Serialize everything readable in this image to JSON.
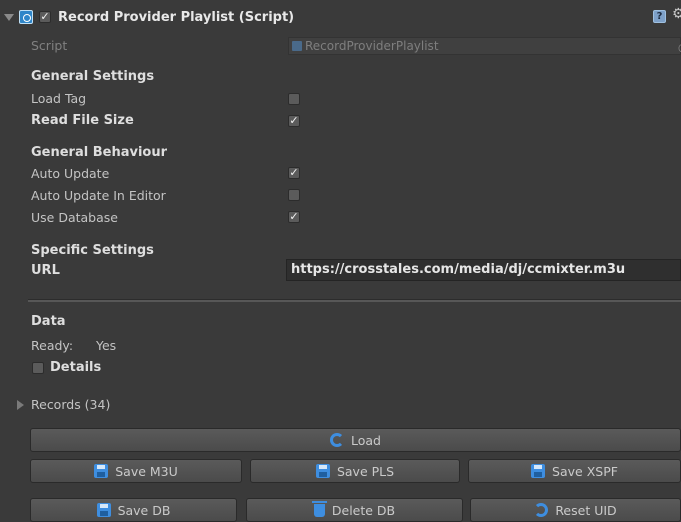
{
  "header": {
    "title": "Record Provider Playlist (Script)",
    "enabled_check": "✓",
    "help_glyph": "?",
    "gear_glyph": "⚙",
    "icons": [
      "foldout-down-icon",
      "script-icon",
      "help-icon",
      "gear-icon"
    ]
  },
  "script_row": {
    "label": "Script",
    "value": "RecordProviderPlaylist"
  },
  "general_settings": {
    "heading": "General Settings",
    "load_tag": {
      "label": "Load Tag",
      "checked": false,
      "mark": ""
    },
    "read_file_size": {
      "label": "Read File Size",
      "checked": true,
      "mark": "✓"
    }
  },
  "general_behaviour": {
    "heading": "General Behaviour",
    "auto_update": {
      "label": "Auto Update",
      "checked": true,
      "mark": "✓"
    },
    "auto_update_editor": {
      "label": "Auto Update In Editor",
      "checked": false,
      "mark": ""
    },
    "use_database": {
      "label": "Use Database",
      "checked": true,
      "mark": "✓"
    }
  },
  "specific_settings": {
    "heading": "Specific Settings",
    "url_label": "URL",
    "url_value": "https://crosstales.com/media/dj/ccmixter.m3u"
  },
  "data_section": {
    "heading": "Data",
    "ready_label": "Ready:",
    "ready_value": "Yes",
    "details_label": "Details",
    "details_checked": false
  },
  "records": {
    "label": "Records (34)"
  },
  "buttons": {
    "load": "Load",
    "save_m3u": "Save M3U",
    "save_pls": "Save PLS",
    "save_xspf": "Save XSPF",
    "save_db": "Save DB",
    "delete_db": "Delete DB",
    "reset_uid": "Reset UID"
  },
  "colors": {
    "background": "#3a3a3a",
    "accent": "#3e8ee0",
    "text": "#c4c4c4"
  }
}
